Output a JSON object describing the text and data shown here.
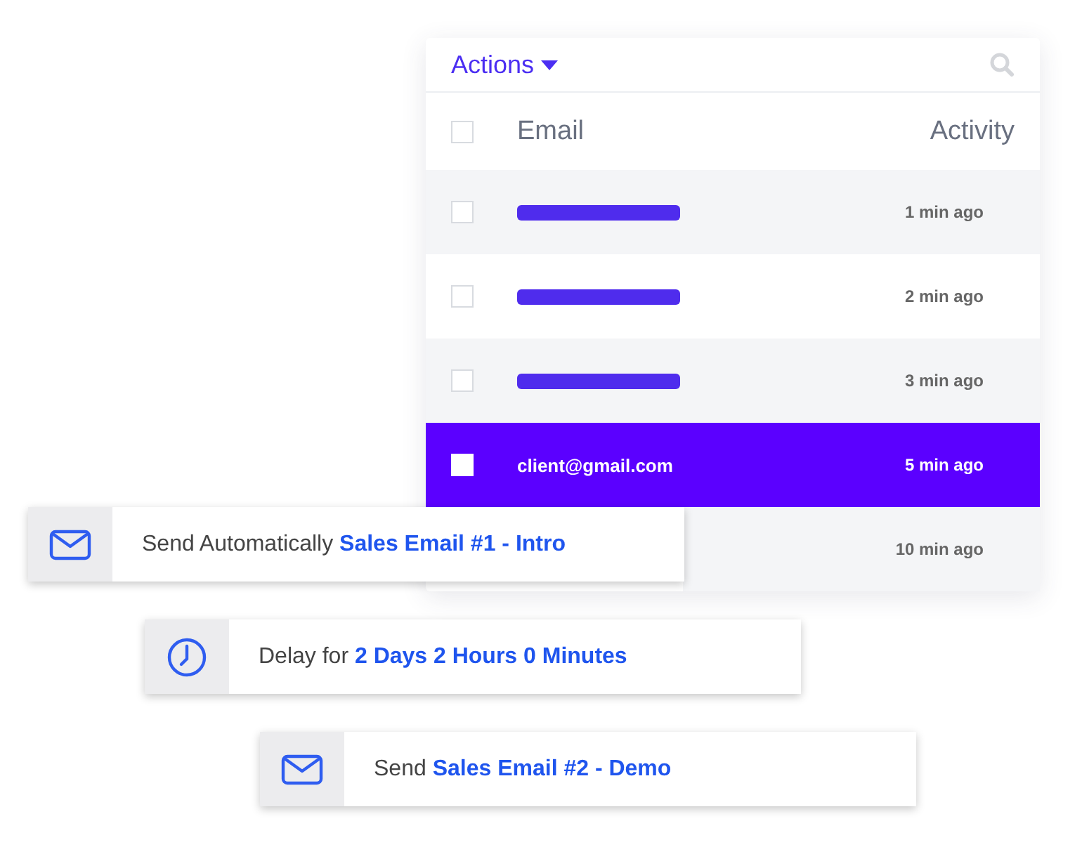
{
  "table": {
    "actions_menu": "Actions",
    "columns": [
      "Email",
      "Activity"
    ],
    "header_checked": false,
    "rows": [
      {
        "kind": "redacted",
        "checked": false,
        "selected": false,
        "activity": "1 min ago"
      },
      {
        "kind": "redacted",
        "checked": false,
        "selected": false,
        "activity": "2 min ago"
      },
      {
        "kind": "redacted",
        "checked": false,
        "selected": false,
        "activity": "3 min ago"
      },
      {
        "kind": "text",
        "email": "client@gmail.com",
        "checked": false,
        "selected": true,
        "activity": "5 min ago"
      },
      {
        "kind": "hidden",
        "selected": false,
        "activity": "10 min ago"
      }
    ]
  },
  "steps": [
    {
      "kind": "mail",
      "text": "Send Automatically **Sales Email #1 - Intro**"
    },
    {
      "kind": "clock",
      "text": "Delay for **2 Days 2 Hours 0 Minutes**"
    },
    {
      "kind": "mail",
      "text": "Send **Sales Email #2 - Demo**"
    }
  ]
}
